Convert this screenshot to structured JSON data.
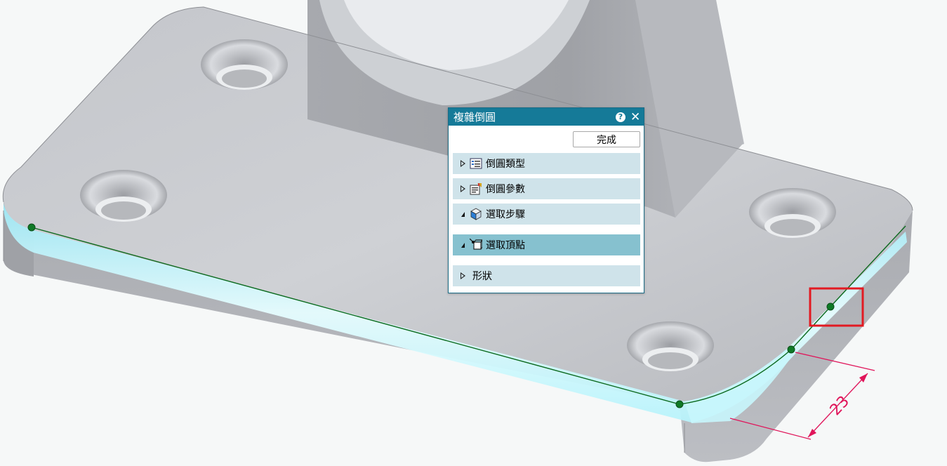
{
  "dialog": {
    "title": "複雜倒圓",
    "help_icon": "?",
    "close_icon": "✕",
    "done_label": "完成",
    "sections": [
      {
        "label": "倒圓類型",
        "icon": "list-icon",
        "state": "collapsed"
      },
      {
        "label": "倒圓參數",
        "icon": "parameters-icon",
        "state": "collapsed"
      },
      {
        "label": "選取步驟",
        "icon": "cube-icon",
        "state": "expanded"
      },
      {
        "label": "選取頂點",
        "icon": "vertex-select-icon",
        "state": "expanded",
        "active": true
      },
      {
        "label": "形狀",
        "icon": "",
        "state": "collapsed"
      }
    ]
  },
  "viewport": {
    "dimension_value": "23",
    "colors": {
      "part_surface": "#c9cbcf",
      "fillet_highlight": "#aef2fb",
      "edge_line": "#0c6a1e",
      "dimension": "#e0155a",
      "selection_box": "#e21a22"
    }
  }
}
